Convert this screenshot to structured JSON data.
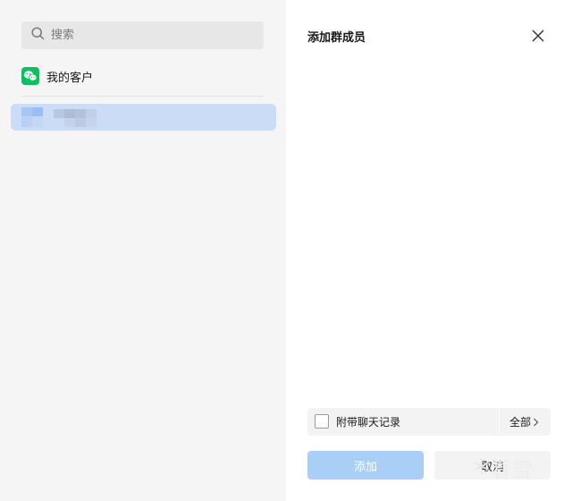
{
  "left_panel": {
    "search": {
      "placeholder": "搜索",
      "icon": "search-icon"
    },
    "customers": {
      "label": "我的客户",
      "icon": "wechat-icon",
      "icon_color": "#07c160"
    },
    "selected_contact": {
      "highlight_color": "#cbdcf6",
      "avatar": "pixelated-blurred"
    }
  },
  "dialog": {
    "title": "添加群成员",
    "close_icon": "close-icon",
    "history": {
      "label": "附带聊天记录",
      "checked": false,
      "range_label": "全部",
      "range_icon": "chevron-right-icon"
    },
    "buttons": {
      "add_label": "添加",
      "add_color": "#a9cff7",
      "cancel_label": "取消"
    }
  },
  "watermark": {
    "text": "看雪",
    "icon": "snowflake-icon"
  }
}
